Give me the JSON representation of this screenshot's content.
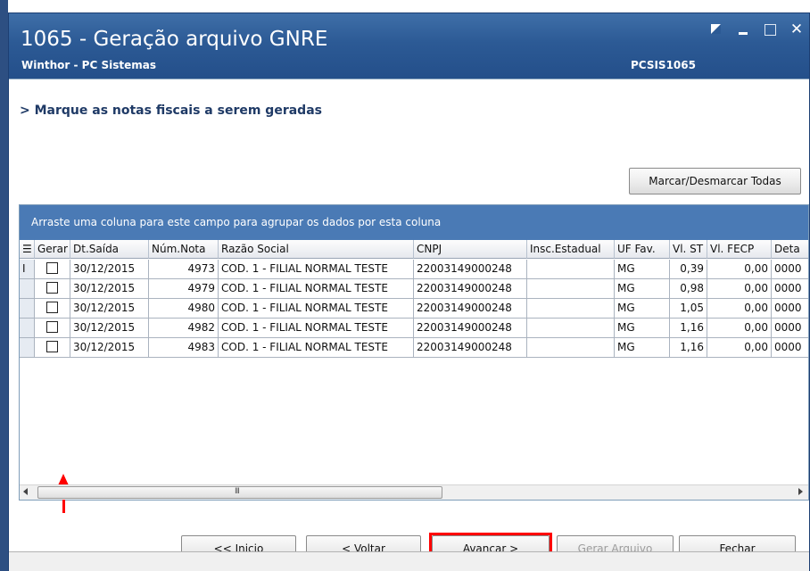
{
  "window": {
    "title": "1065 - Geração arquivo GNRE",
    "subtitle": "Winthor - PC Sistemas",
    "code": "PCSIS1065",
    "controls": {
      "close_glyph": "✕"
    }
  },
  "instruction": "> Marque as notas fiscais a serem geradas",
  "toggle_all_button": "Marcar/Desmarcar Todas",
  "grid": {
    "group_panel_text": "Arraste uma coluna para este campo para agrupar os dados por esta coluna",
    "columns": [
      "Gerar",
      "Dt.Saída",
      "Núm.Nota",
      "Razão Social",
      "CNPJ",
      "Insc.Estadual",
      "UF Fav.",
      "Vl. ST",
      "Vl. FECP",
      "Deta"
    ],
    "rows": [
      {
        "date": "30/12/2015",
        "nota": "4973",
        "razao": "COD. 1 - FILIAL NORMAL TESTE",
        "cnpj": "22003149000248",
        "ie": "",
        "uf": "MG",
        "st": "0,39",
        "fecp": "0,00",
        "det": "0000"
      },
      {
        "date": "30/12/2015",
        "nota": "4979",
        "razao": "COD. 1 - FILIAL NORMAL TESTE",
        "cnpj": "22003149000248",
        "ie": "",
        "uf": "MG",
        "st": "0,98",
        "fecp": "0,00",
        "det": "0000"
      },
      {
        "date": "30/12/2015",
        "nota": "4980",
        "razao": "COD. 1 - FILIAL NORMAL TESTE",
        "cnpj": "22003149000248",
        "ie": "",
        "uf": "MG",
        "st": "1,05",
        "fecp": "0,00",
        "det": "0000"
      },
      {
        "date": "30/12/2015",
        "nota": "4982",
        "razao": "COD. 1 - FILIAL NORMAL TESTE",
        "cnpj": "22003149000248",
        "ie": "",
        "uf": "MG",
        "st": "1,16",
        "fecp": "0,00",
        "det": "0000"
      },
      {
        "date": "30/12/2015",
        "nota": "4983",
        "razao": "COD. 1 - FILIAL NORMAL TESTE",
        "cnpj": "22003149000248",
        "ie": "",
        "uf": "MG",
        "st": "1,16",
        "fecp": "0,00",
        "det": "0000"
      }
    ],
    "row_cursor_glyph": "I",
    "scroll_grip": "III"
  },
  "nav_buttons": {
    "inicio": "<< Inicio",
    "voltar": "< Voltar",
    "avancar": "Avançar >",
    "gerar": "Gerar Arquivo",
    "fechar": "Fechar"
  },
  "colors": {
    "titlebar": "#2c5a95",
    "group_panel": "#4a7ab5",
    "highlight": "#ff0000"
  }
}
